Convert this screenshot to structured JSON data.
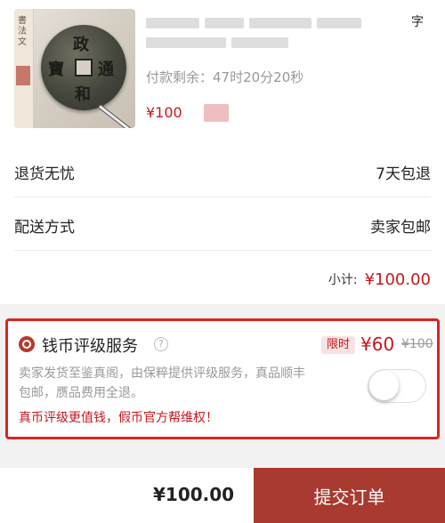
{
  "product": {
    "title_visible_char": "字",
    "countdown": "付款剩余：47时20分20秒",
    "price_prefix": "¥100"
  },
  "rows": [
    {
      "label": "退货无忧",
      "value": "7天包退"
    },
    {
      "label": "配送方式",
      "value": "卖家包邮"
    }
  ],
  "subtotal": {
    "label": "小计:",
    "value": "¥100.00"
  },
  "service": {
    "name": "钱币评级服务",
    "help_symbol": "?",
    "tag": "限时",
    "price_now": "¥60",
    "price_old": "¥100",
    "description": "卖家发货至鉴真阁，由保粹提供评级服务，真品顺丰包邮，赝品费用全退。",
    "slogan": "真币评级更值钱，假币官方帮维权！",
    "enabled": false
  },
  "footer": {
    "total": "¥100.00",
    "submit_label": "提交订单"
  },
  "colors": {
    "accent_red": "#c6171c",
    "submit_bg": "#a83a30",
    "highlight_border": "#e0231e"
  }
}
